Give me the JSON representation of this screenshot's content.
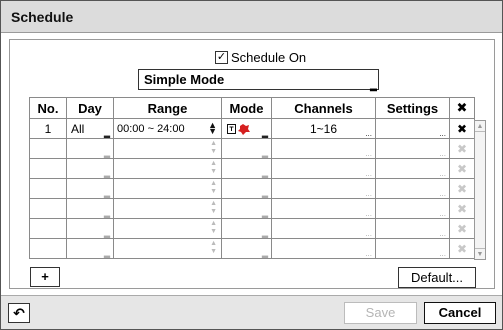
{
  "window": {
    "title": "Schedule"
  },
  "schedule_on": {
    "label": "Schedule On",
    "checked": true
  },
  "mode_select": {
    "value": "Simple Mode"
  },
  "table": {
    "headers": [
      "No.",
      "Day",
      "Range",
      "Mode",
      "Channels",
      "Settings",
      "✖"
    ],
    "rows": [
      {
        "no": "1",
        "day": "All",
        "range": "00:00 ~ 24:00",
        "mode": "",
        "channels": "1~16",
        "settings": ""
      }
    ],
    "empty_row_count": 6
  },
  "buttons": {
    "add": "+",
    "default": "Default...",
    "back": "↶",
    "save": "Save",
    "cancel": "Cancel"
  }
}
